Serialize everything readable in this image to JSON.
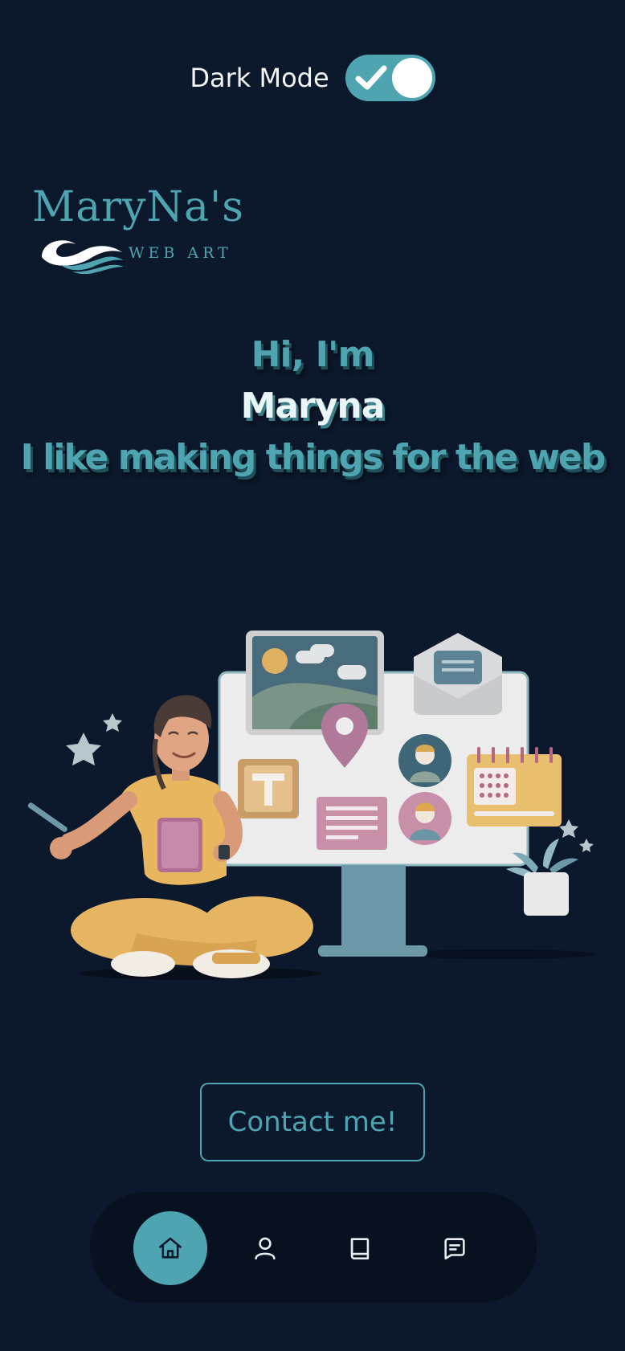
{
  "toggle": {
    "label": "Dark Mode",
    "state": "on"
  },
  "logo": {
    "title": "MaryNa's",
    "subtitle": "WEB ART"
  },
  "hero": {
    "line1": "Hi, I'm",
    "line2": "Maryna",
    "line3": "I like making things for the web"
  },
  "contact": {
    "label": "Contact me!"
  },
  "nav": {
    "items": [
      {
        "icon": "home-icon",
        "active": true
      },
      {
        "icon": "user-icon",
        "active": false
      },
      {
        "icon": "book-icon",
        "active": false
      },
      {
        "icon": "message-icon",
        "active": false
      }
    ]
  },
  "colors": {
    "background": "#0c182b",
    "accent": "#4ea5b1",
    "nav_background": "#07111f"
  }
}
